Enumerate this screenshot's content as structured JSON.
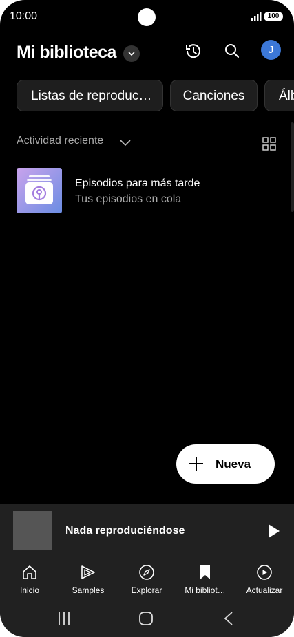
{
  "status": {
    "time": "10:00",
    "battery": "100"
  },
  "header": {
    "title": "Mi biblioteca",
    "avatar_letter": "J"
  },
  "chips": [
    "Listas de reproduc…",
    "Canciones",
    "Álb"
  ],
  "sort": {
    "label": "Actividad reciente"
  },
  "items": [
    {
      "title": "Episodios para más tarde",
      "subtitle": "Tus episodios en cola"
    }
  ],
  "fab": {
    "label": "Nueva"
  },
  "miniplayer": {
    "title": "Nada reproduciéndose"
  },
  "nav": [
    {
      "label": "Inicio",
      "icon": "home-icon"
    },
    {
      "label": "Samples",
      "icon": "samples-icon"
    },
    {
      "label": "Explorar",
      "icon": "compass-icon"
    },
    {
      "label": "Mi bibliot…",
      "icon": "bookmark-icon"
    },
    {
      "label": "Actualizar",
      "icon": "upgrade-icon"
    }
  ],
  "colors": {
    "background": "#000000",
    "surface": "#212121",
    "chip": "#1e1e1e",
    "avatar": "#3c78d8"
  }
}
